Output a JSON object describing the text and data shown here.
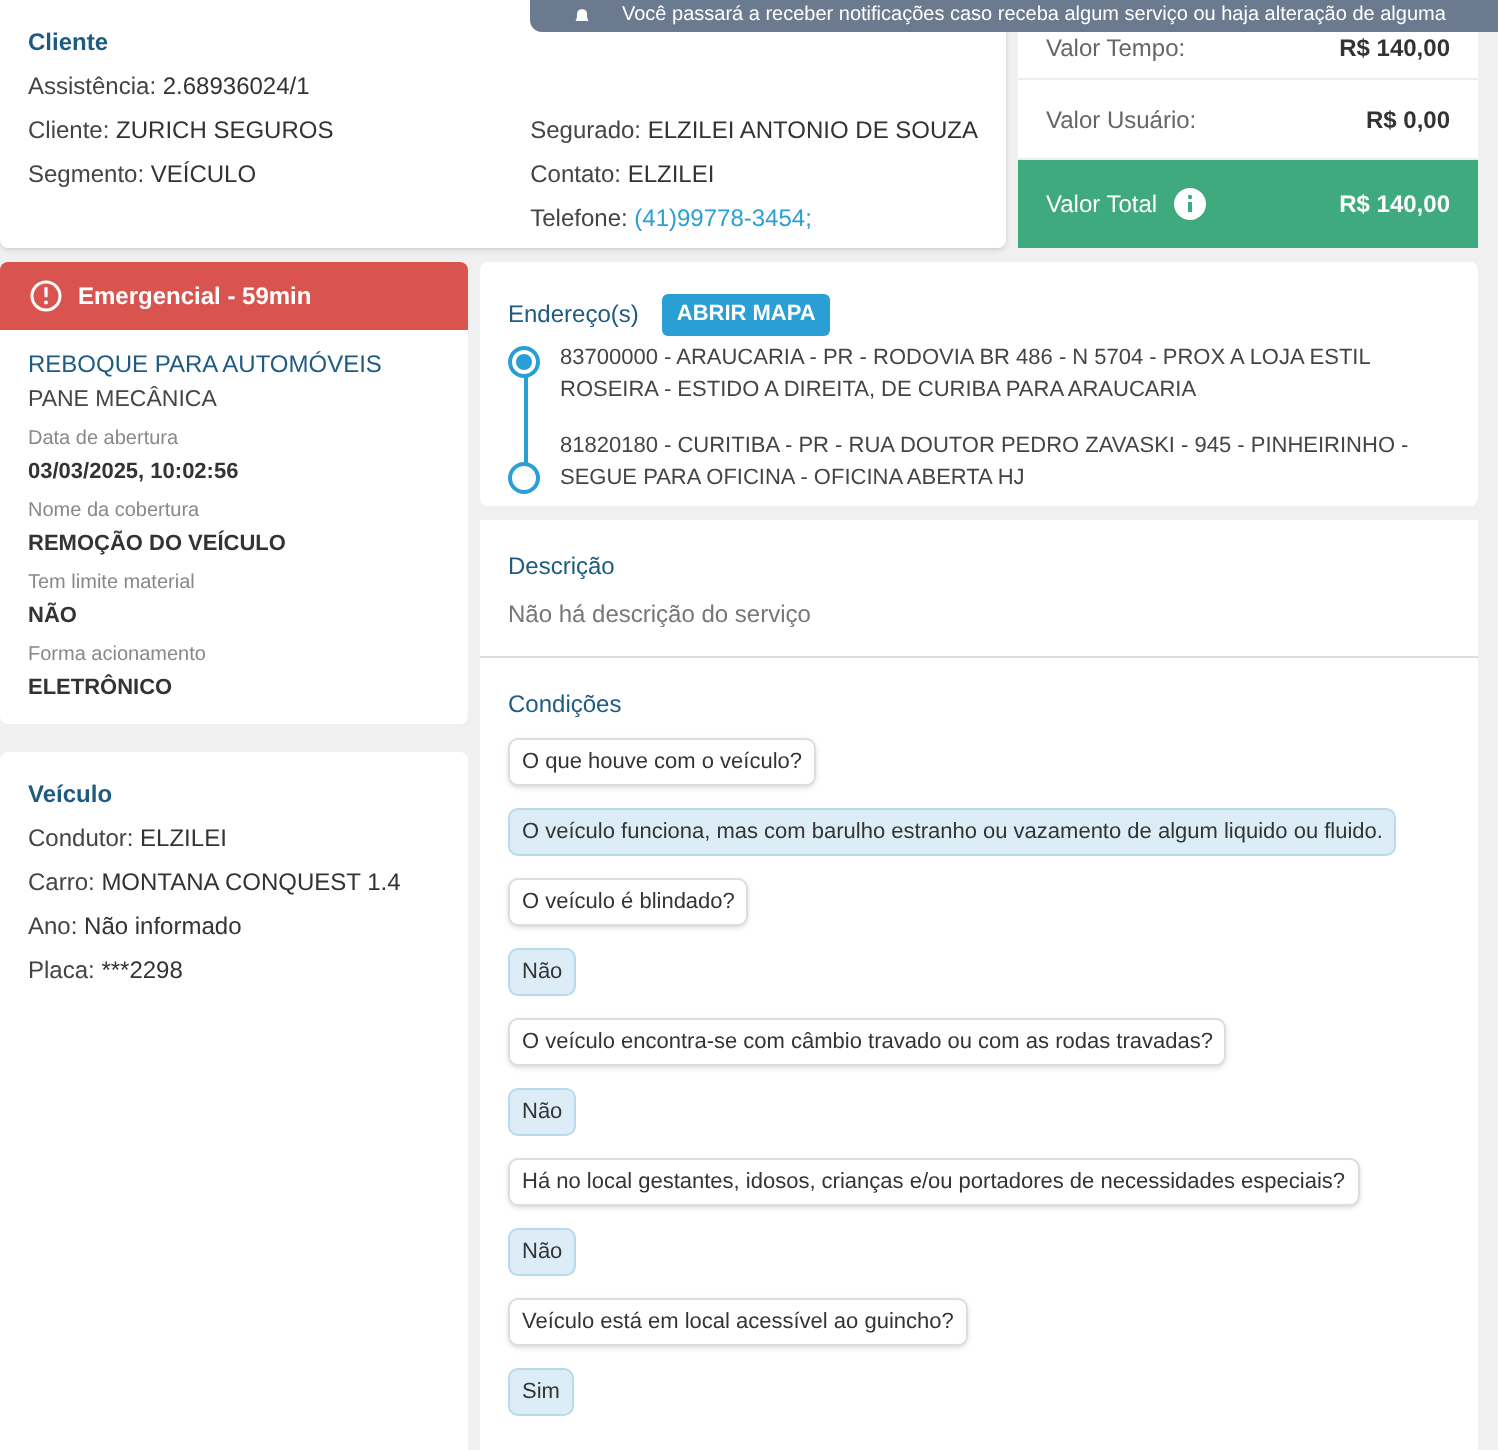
{
  "notification": {
    "text": "Você passará a receber notificações caso receba algum serviço ou haja alteração de alguma"
  },
  "cliente": {
    "title": "Cliente",
    "left": [
      {
        "label": "Assistência:",
        "value": "2.68936024/1"
      },
      {
        "label": "Cliente:",
        "value": "ZURICH SEGUROS"
      },
      {
        "label": "Segmento:",
        "value": "VEÍCULO"
      }
    ],
    "right": [
      {
        "label": "Segurado:",
        "value": "ELZILEI ANTONIO DE SOUZA",
        "kind": "text"
      },
      {
        "label": "Contato:",
        "value": "ELZILEI",
        "kind": "text"
      },
      {
        "label": "Telefone:",
        "value": "(41)99778-3454;",
        "kind": "link"
      }
    ]
  },
  "valores": {
    "rows": [
      {
        "label": "Valor Tempo:",
        "value": "R$ 140,00"
      },
      {
        "label": "Valor Usuário:",
        "value": "R$ 0,00"
      }
    ],
    "total": {
      "label": "Valor Total",
      "value": "R$ 140,00"
    }
  },
  "servico": {
    "badge": "Emergencial - 59min",
    "title": "REBOQUE PARA AUTOMÓVEIS",
    "subtitle": "PANE MECÂNICA",
    "fields": [
      {
        "label": "Data de abertura",
        "value": "03/03/2025, 10:02:56"
      },
      {
        "label": "Nome da cobertura",
        "value": "REMOÇÃO DO VEÍCULO"
      },
      {
        "label": "Tem limite material",
        "value": "NÃO"
      },
      {
        "label": "Forma acionamento",
        "value": "ELETRÔNICO"
      }
    ]
  },
  "veiculo": {
    "title": "Veículo",
    "rows": [
      {
        "label": "Condutor:",
        "value": "ELZILEI"
      },
      {
        "label": "Carro:",
        "value": "MONTANA CONQUEST 1.4"
      },
      {
        "label": "Ano:",
        "value": "Não informado"
      },
      {
        "label": "Placa:",
        "value": "***2298"
      }
    ]
  },
  "enderecos": {
    "title": "Endereço(s)",
    "button": "ABRIR MAPA",
    "items": [
      {
        "text": "83700000 - ARAUCARIA - PR - RODOVIA BR 486 - N 5704 - PROX A LOJA ESTIL ROSEIRA - ESTIDO A DIREITA, DE CURIBA PARA ARAUCARIA",
        "selected": true
      },
      {
        "text": "81820180 - CURITIBA - PR - RUA DOUTOR PEDRO ZAVASKI - 945 - PINHEIRINHO - SEGUE PARA OFICINA - OFICINA ABERTA HJ",
        "selected": false
      }
    ]
  },
  "descricao": {
    "title": "Descrição",
    "text": "Não há descrição do serviço"
  },
  "condicoes": {
    "title": "Condições",
    "items": [
      {
        "kind": "question",
        "text": "O que houve com o veículo?"
      },
      {
        "kind": "answer",
        "text": "O veículo funciona, mas com barulho estranho ou vazamento de algum liquido ou fluido."
      },
      {
        "kind": "question",
        "text": "O veículo é blindado?"
      },
      {
        "kind": "answer",
        "text": "Não"
      },
      {
        "kind": "question",
        "text": "O veículo encontra-se com câmbio travado ou com as rodas travadas?"
      },
      {
        "kind": "answer",
        "text": "Não"
      },
      {
        "kind": "question",
        "text": "Há no local gestantes, idosos, crianças e/ou portadores de necessidades especiais?"
      },
      {
        "kind": "answer",
        "text": "Não"
      },
      {
        "kind": "question",
        "text": "Veículo está em local acessível ao guincho?"
      },
      {
        "kind": "answer",
        "text": "Sim"
      }
    ]
  }
}
